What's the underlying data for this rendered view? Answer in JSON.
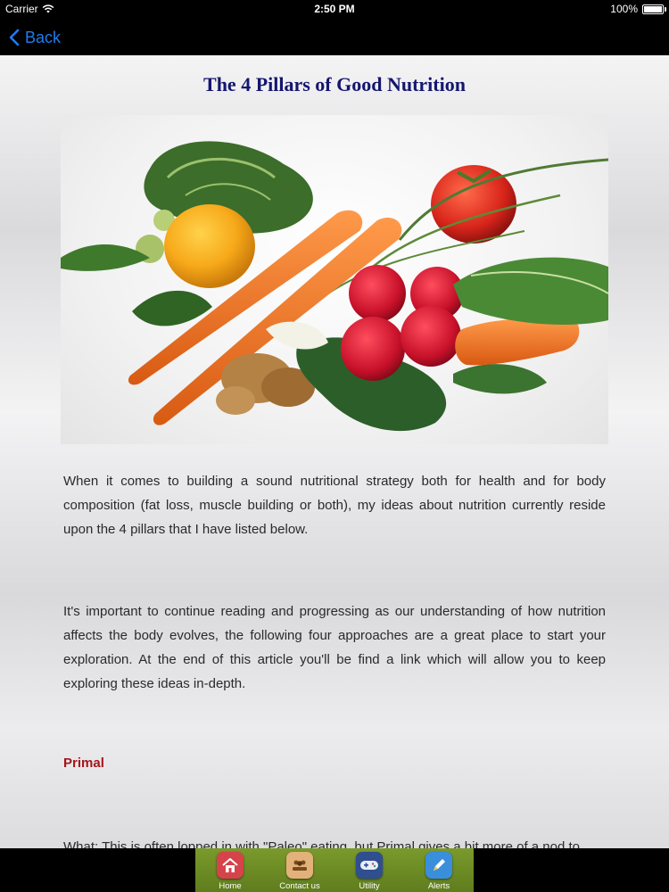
{
  "status_bar": {
    "carrier": "Carrier",
    "time": "2:50 PM",
    "battery": "100%",
    "battery_level": 1.0
  },
  "nav": {
    "back_label": "Back"
  },
  "article": {
    "title": "The 4 Pillars of Good Nutrition",
    "image_icon": "vegetables-photo",
    "paragraphs": [
      "When it comes to building a sound nutritional strategy both for health and for body composition (fat loss, muscle building or both), my ideas about nutrition currently reside upon the 4 pillars that I have listed below.",
      "It's important to continue reading and progressing as our understanding of how nutrition affects the body evolves, the following four approaches are a great place to start your exploration. At the end of this article you'll be find a link which will allow you to keep exploring these ideas in-depth.",
      "What: This is often lopped in with \"Paleo\" eating, but Primal gives a bit more of a nod to"
    ],
    "section_heading": "Primal"
  },
  "tab_bar": {
    "items": [
      {
        "label": "Home",
        "icon": "home-icon",
        "color": "#d6434a"
      },
      {
        "label": "Contact us",
        "icon": "contact-icon",
        "color": "#e3b17a"
      },
      {
        "label": "Utility",
        "icon": "gamepad-icon",
        "color": "#2f4f8f"
      },
      {
        "label": "Alerts",
        "icon": "pen-icon",
        "color": "#3a8fdc"
      }
    ]
  },
  "colors": {
    "title": "#14166e",
    "heading": "#a4161c",
    "link_blue": "#1e7cf2",
    "tab_green": "#6c8b24"
  }
}
